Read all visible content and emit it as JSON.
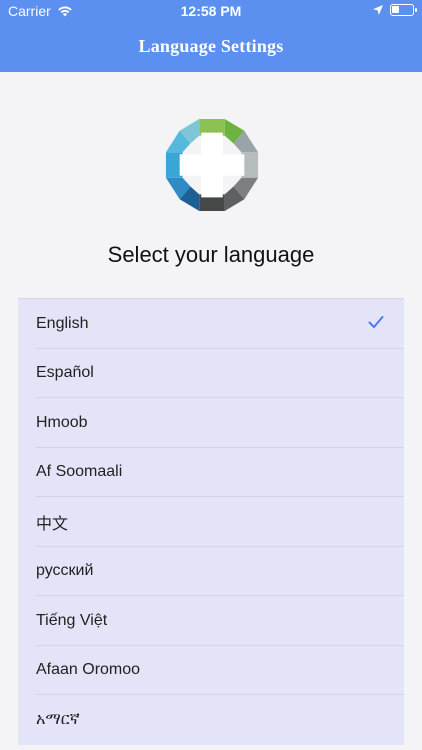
{
  "status_bar": {
    "carrier": "Carrier",
    "time": "12:58 PM",
    "battery_level": 0.35
  },
  "nav": {
    "title": "Language Settings"
  },
  "main": {
    "heading": "Select your language"
  },
  "languages": [
    {
      "label": "English",
      "selected": true
    },
    {
      "label": "Español",
      "selected": false
    },
    {
      "label": "Hmoob",
      "selected": false
    },
    {
      "label": "Af Soomaali",
      "selected": false
    },
    {
      "label": "中文",
      "selected": false
    },
    {
      "label": "русский",
      "selected": false
    },
    {
      "label": "Tiếng Việt",
      "selected": false
    },
    {
      "label": "Afaan Oromoo",
      "selected": false
    },
    {
      "label": "አማርኛ",
      "selected": false
    }
  ],
  "colors": {
    "accent": "#5b8ff0",
    "check": "#4a7be6",
    "list_bg": "#e4e4f8"
  }
}
